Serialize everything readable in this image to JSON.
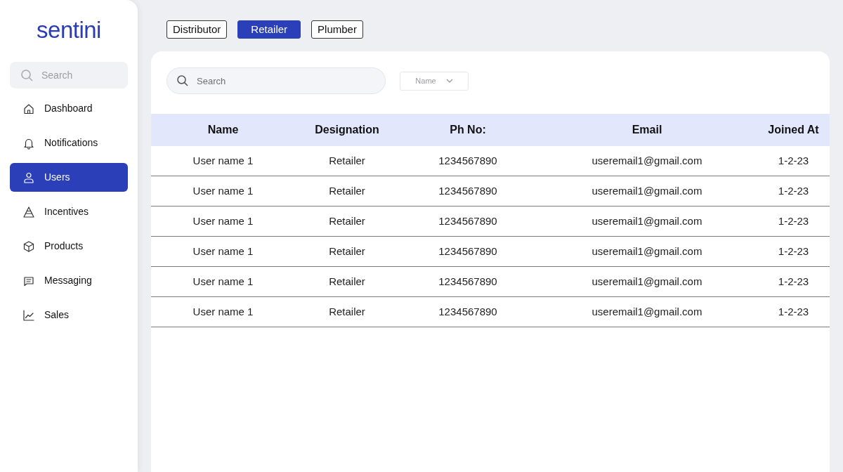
{
  "sidebar": {
    "logo": "sentini",
    "search": {
      "placeholder": "Search"
    },
    "items": [
      {
        "label": "Dashboard",
        "selected": false
      },
      {
        "label": "Notifications",
        "selected": false
      },
      {
        "label": "Users",
        "selected": true
      },
      {
        "label": "Incentives",
        "selected": false
      },
      {
        "label": "Products",
        "selected": false
      },
      {
        "label": "Messaging",
        "selected": false
      },
      {
        "label": "Sales",
        "selected": false
      }
    ]
  },
  "filter_tabs": [
    {
      "label": "Distributor",
      "selected": false
    },
    {
      "label": "Retailer",
      "selected": true
    },
    {
      "label": "Plumber",
      "selected": false
    }
  ],
  "search": {
    "placeholder": "Search"
  },
  "sort_dropdown": {
    "value": "Name"
  },
  "table": {
    "columns": [
      "Name",
      "Designation",
      "Ph No:",
      "Email",
      "Joined At"
    ],
    "rows": [
      [
        "User name 1",
        "Retailer",
        "1234567890",
        "useremail1@gmail.com",
        "1-2-23"
      ],
      [
        "User name 1",
        "Retailer",
        "1234567890",
        "useremail1@gmail.com",
        "1-2-23"
      ],
      [
        "User name 1",
        "Retailer",
        "1234567890",
        "useremail1@gmail.com",
        "1-2-23"
      ],
      [
        "User name 1",
        "Retailer",
        "1234567890",
        "useremail1@gmail.com",
        "1-2-23"
      ],
      [
        "User name 1",
        "Retailer",
        "1234567890",
        "useremail1@gmail.com",
        "1-2-23"
      ],
      [
        "User name 1",
        "Retailer",
        "1234567890",
        "useremail1@gmail.com",
        "1-2-23"
      ]
    ]
  }
}
